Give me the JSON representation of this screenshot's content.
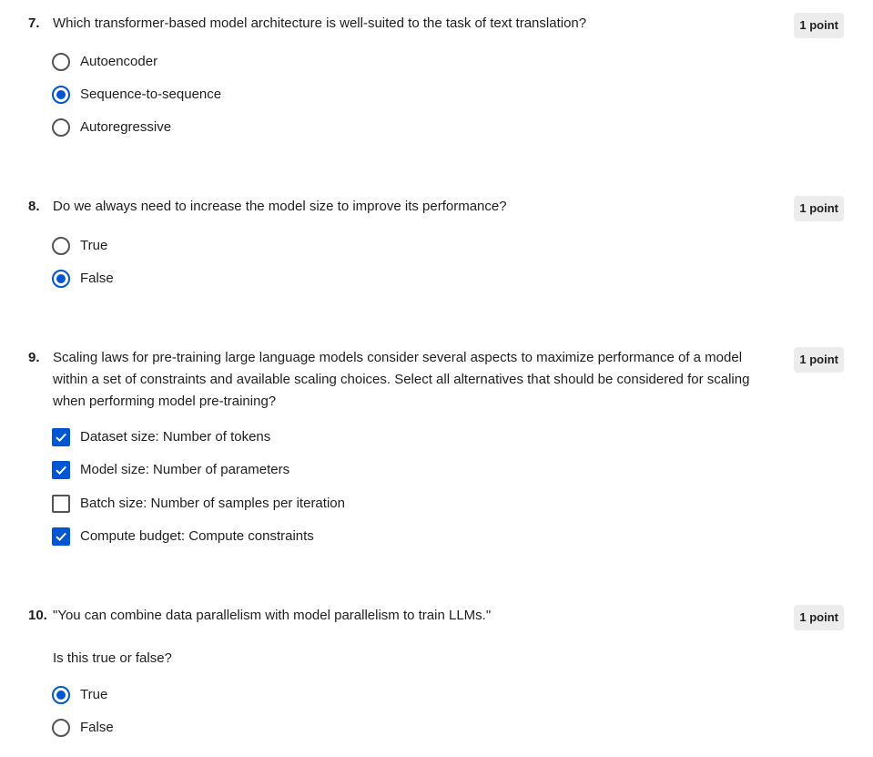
{
  "questions": [
    {
      "number": "7.",
      "text": "Which transformer-based model architecture is well-suited to the task of text translation?",
      "points": "1 point",
      "options": [
        {
          "label": "Autoencoder",
          "checked": false
        },
        {
          "label": "Sequence-to-sequence",
          "checked": true
        },
        {
          "label": "Autoregressive",
          "checked": false
        }
      ]
    },
    {
      "number": "8.",
      "text": "Do we always need to increase the model size to improve its performance?",
      "points": "1 point",
      "options": [
        {
          "label": "True",
          "checked": false
        },
        {
          "label": "False",
          "checked": true
        }
      ]
    },
    {
      "number": "9.",
      "text": "Scaling laws for pre-training large language models consider several aspects to maximize performance of a model within a set of constraints and available scaling choices.  Select all alternatives that should be considered for scaling when performing model pre-training?",
      "points": "1 point",
      "options": [
        {
          "label": "Dataset size: Number of tokens",
          "checked": true
        },
        {
          "label": "Model size: Number of parameters",
          "checked": true
        },
        {
          "label": "Batch size: Number of samples per iteration",
          "checked": false
        },
        {
          "label": "Compute budget: Compute constraints",
          "checked": true
        }
      ]
    },
    {
      "number": "10.",
      "text": "\"You can combine data parallelism with model parallelism to train LLMs.\"",
      "subtext": "Is this true or false?",
      "points": "1 point",
      "options": [
        {
          "label": "True",
          "checked": true
        },
        {
          "label": "False",
          "checked": false
        }
      ]
    }
  ],
  "colors": {
    "accent": "#0056d2",
    "text": "#1f1f1f",
    "badge_bg": "#ececec",
    "control_border": "#545454"
  }
}
